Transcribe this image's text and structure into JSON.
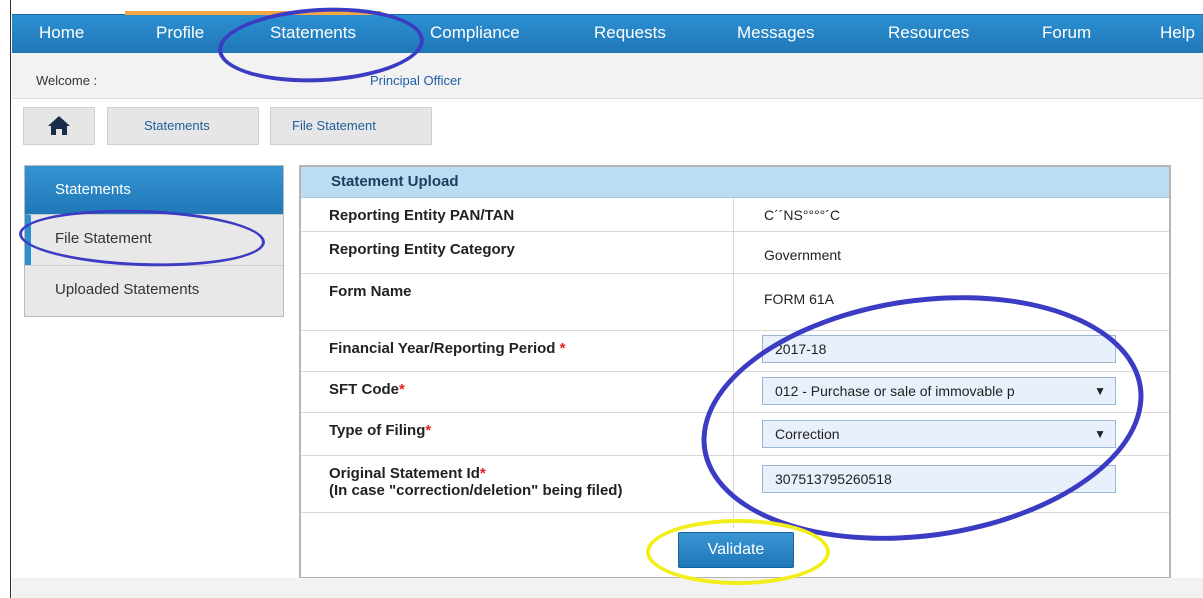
{
  "nav": {
    "items": [
      "Home",
      "Profile",
      "Statements",
      "Compliance",
      "Requests",
      "Messages",
      "Resources",
      "Forum",
      "Help"
    ]
  },
  "welcome": {
    "prefix": "Welcome :",
    "role": "Principal Officer"
  },
  "breadcrumb": {
    "items": [
      "Statements",
      "File Statement"
    ]
  },
  "sidebar": {
    "title": "Statements",
    "items": [
      {
        "label": "File Statement",
        "active": true
      },
      {
        "label": "Uploaded Statements",
        "active": false
      }
    ]
  },
  "panel": {
    "title": "Statement Upload",
    "rows": [
      {
        "label": "Reporting Entity PAN/TAN",
        "value": "C´´NS°°°°´C"
      },
      {
        "label": "Reporting Entity Category",
        "value": "Government"
      },
      {
        "label": "Form Name",
        "value": "FORM 61A"
      },
      {
        "label": "Financial Year/Reporting Period",
        "value": "2017-18"
      },
      {
        "label": "SFT Code",
        "value": "012 - Purchase or sale of immovable p"
      },
      {
        "label": "Type of Filing",
        "value": "Correction"
      },
      {
        "label": "Original Statement Id",
        "sublabel": "(In case \"correction/deletion\" being filed)",
        "value": "307513795260518"
      }
    ],
    "required_mark": "*",
    "validate_label": "Validate"
  },
  "colors": {
    "nav_bg": "#1f78b8",
    "active_tab": "#f4a742",
    "annotation_blue": "#3b3bc4",
    "annotation_yellow": "#f2ee1c"
  }
}
